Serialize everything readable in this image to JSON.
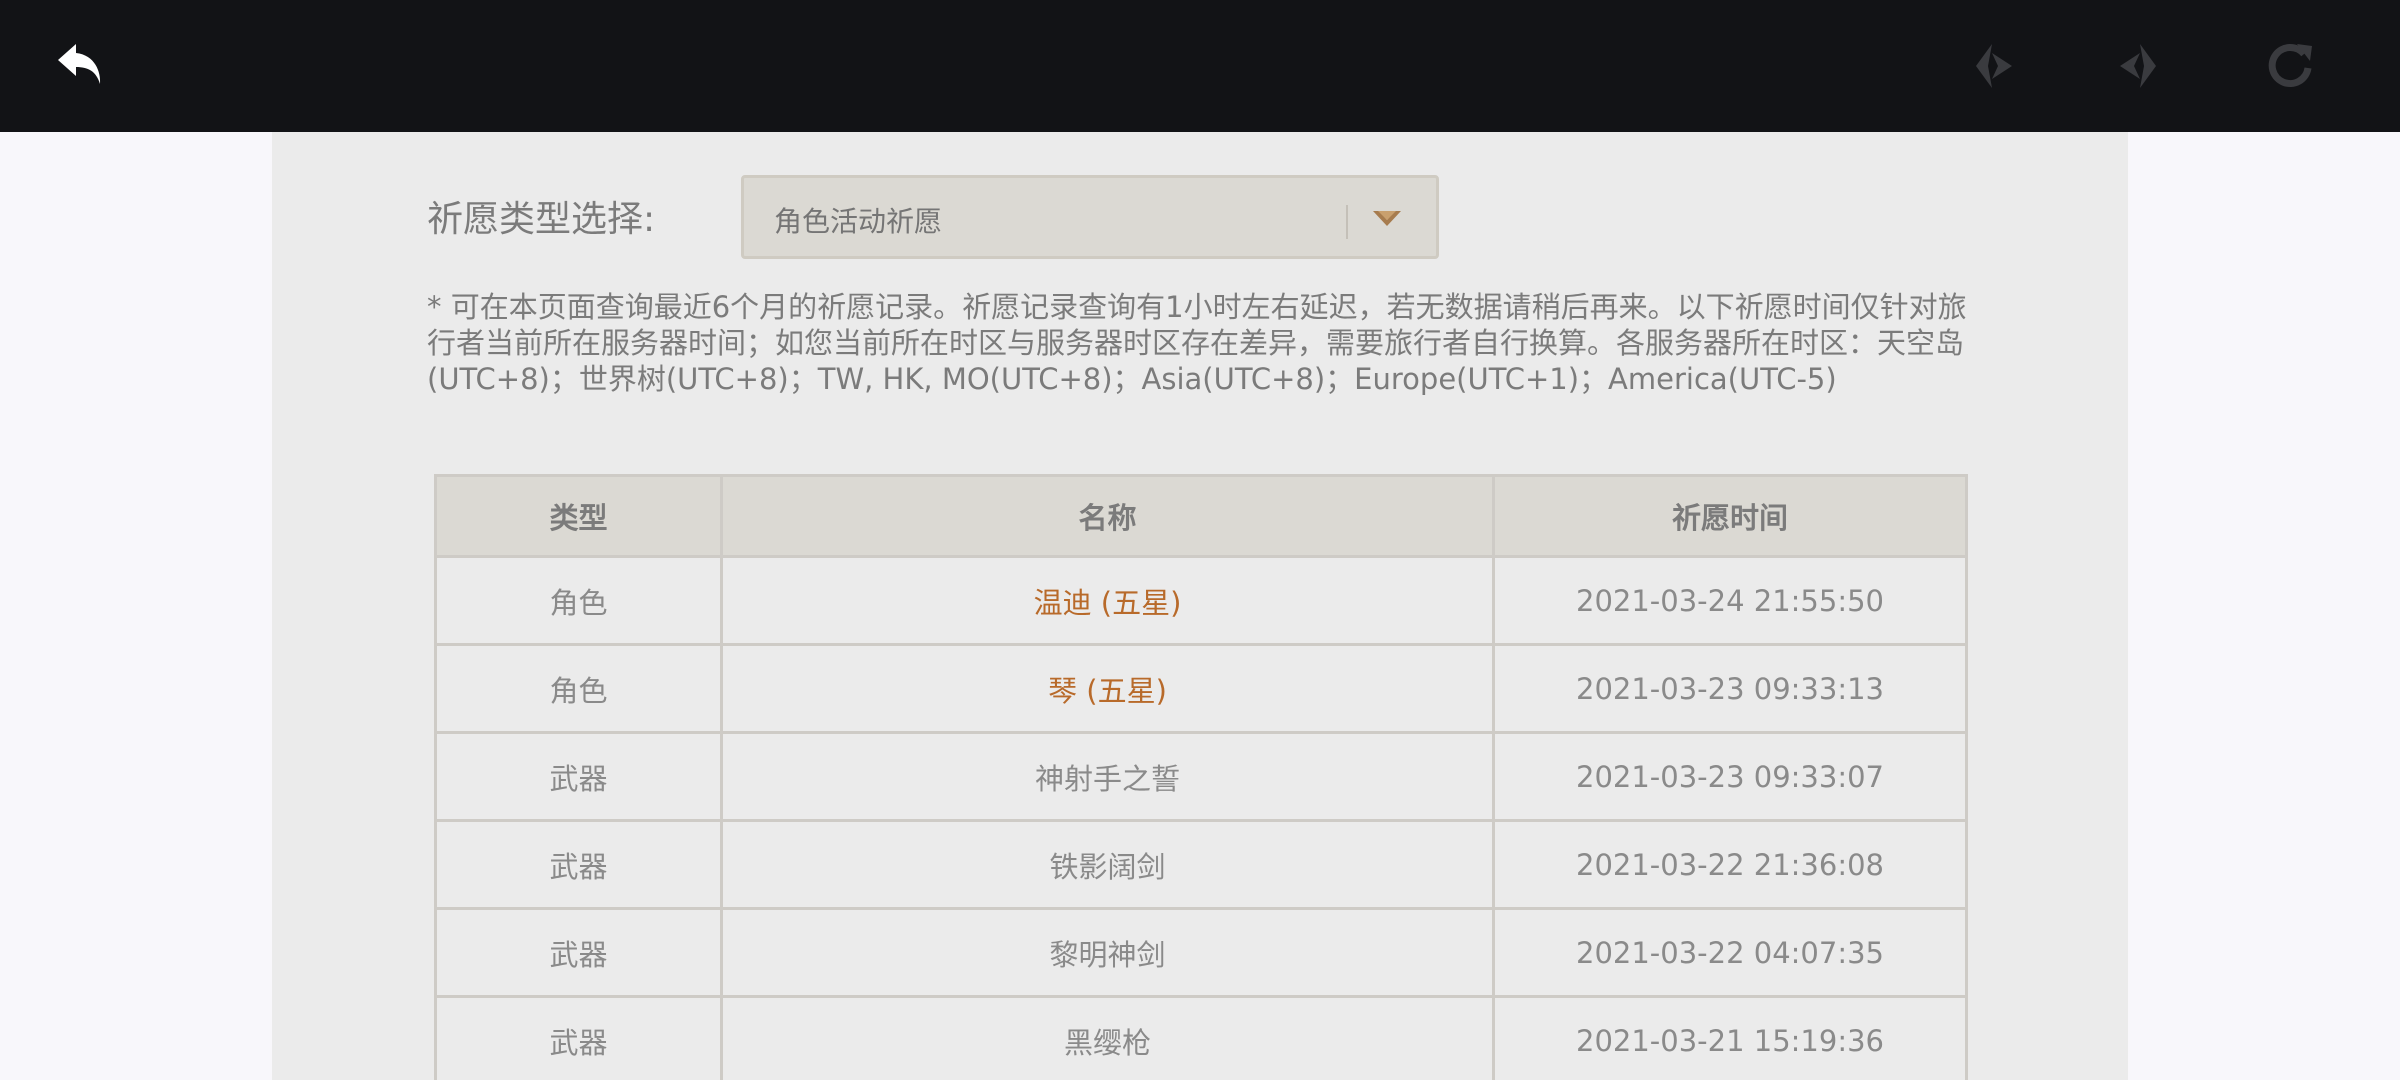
{
  "topbar": {
    "back_icon": "back-arrow-icon",
    "prev_icon": "nav-back-icon",
    "next_icon": "nav-forward-icon",
    "refresh_icon": "refresh-icon"
  },
  "filter": {
    "label": "祈愿类型选择:",
    "selected": "角色活动祈愿",
    "arrow_icon": "chevron-down-icon"
  },
  "notice": "* 可在本页面查询最近6个月的祈愿记录。祈愿记录查询有1小时左右延迟，若无数据请稍后再来。以下祈愿时间仅针对旅行者当前所在服务器时间；如您当前所在时区与服务器时区存在差异，需要旅行者自行换算。各服务器所在时区：天空岛(UTC+8)；世界树(UTC+8)；TW, HK, MO(UTC+8)；Asia(UTC+8)；Europe(UTC+1)；America(UTC-5)",
  "table": {
    "headers": [
      "类型",
      "名称",
      "祈愿时间"
    ],
    "rows": [
      {
        "type": "角色",
        "name": "温迪 (五星)",
        "time": "2021-03-24 21:55:50"
      },
      {
        "type": "角色",
        "name": "琴 (五星)",
        "time": "2021-03-23 09:33:13"
      },
      {
        "type": "武器",
        "name": "神射手之誓",
        "time": "2021-03-23 09:33:07"
      },
      {
        "type": "武器",
        "name": "铁影阔剑",
        "time": "2021-03-22 21:36:08"
      },
      {
        "type": "武器",
        "name": "黎明神剑",
        "time": "2021-03-22 04:07:35"
      },
      {
        "type": "武器",
        "name": "黑缨枪",
        "time": "2021-03-21 15:19:36"
      }
    ]
  },
  "colors": {
    "topbar_bg": "#121316",
    "page_bg": "#ebebeb",
    "five_star": "#b86a2a",
    "text_gray": "#8a8a8a"
  }
}
